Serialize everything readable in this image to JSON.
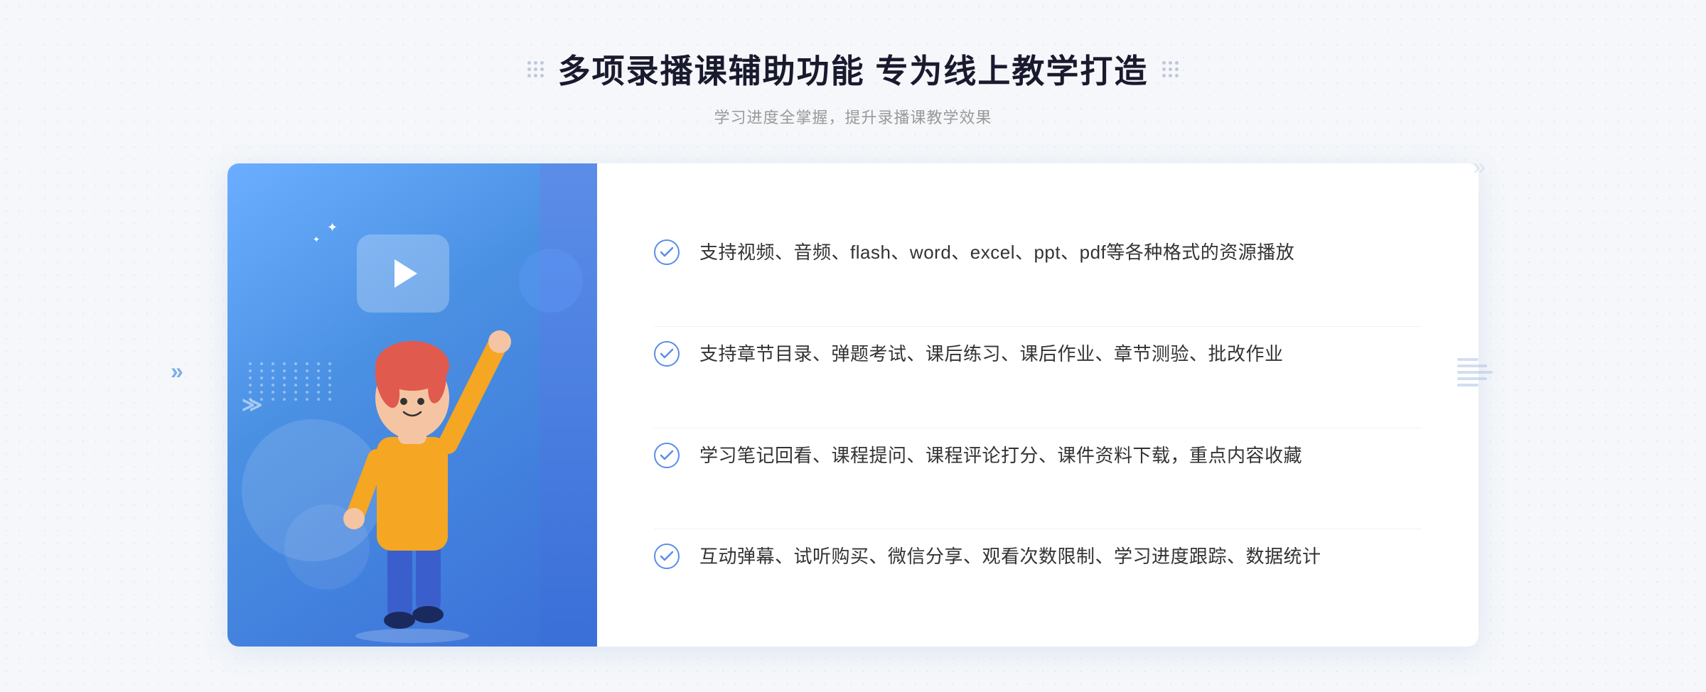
{
  "header": {
    "title": "多项录播课辅助功能 专为线上教学打造",
    "subtitle": "学习进度全掌握，提升录播课教学效果",
    "dots_label": "decorative dots"
  },
  "features": [
    {
      "id": 1,
      "text": "支持视频、音频、flash、word、excel、ppt、pdf等各种格式的资源播放"
    },
    {
      "id": 2,
      "text": "支持章节目录、弹题考试、课后练习、课后作业、章节测验、批改作业"
    },
    {
      "id": 3,
      "text": "学习笔记回看、课程提问、课程评论打分、课件资料下载，重点内容收藏"
    },
    {
      "id": 4,
      "text": "互动弹幕、试听购买、微信分享、观看次数限制、学习进度跟踪、数据统计"
    }
  ],
  "illustration": {
    "play_button_label": "play",
    "alt": "online learning illustration"
  },
  "colors": {
    "accent_blue": "#4a90e2",
    "light_blue": "#6baeff",
    "check_blue": "#5b8de8",
    "text_dark": "#1a1a2e",
    "text_gray": "#999999",
    "text_body": "#333333"
  }
}
